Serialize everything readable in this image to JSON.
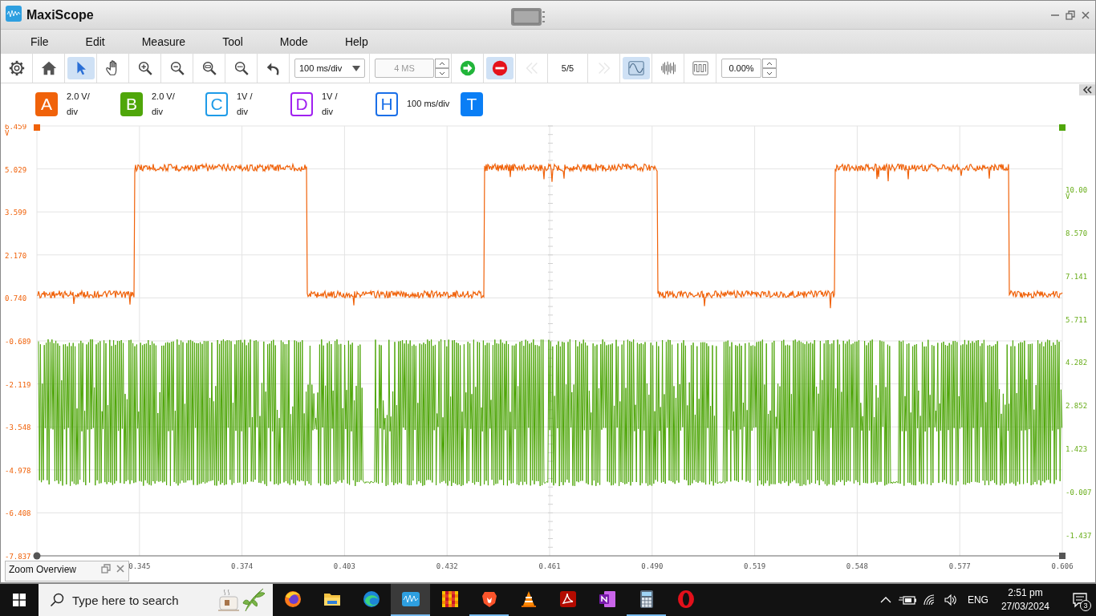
{
  "window": {
    "title": "MaxiScope"
  },
  "menu": [
    {
      "label": "File"
    },
    {
      "label": "Edit"
    },
    {
      "label": "Measure"
    },
    {
      "label": "Tool"
    },
    {
      "label": "Mode"
    },
    {
      "label": "Help"
    }
  ],
  "toolbar": [
    {
      "kind": "settings",
      "selected": false,
      "disabled": false
    },
    {
      "kind": "home",
      "selected": false,
      "disabled": false
    },
    {
      "kind": "pointer",
      "selected": true,
      "disabled": false
    },
    {
      "kind": "hand",
      "selected": false,
      "disabled": false
    },
    {
      "kind": "zoomin",
      "selected": false,
      "disabled": false
    },
    {
      "kind": "zoomout",
      "selected": false,
      "disabled": false
    },
    {
      "kind": "zoomfit",
      "selected": false,
      "disabled": false
    },
    {
      "kind": "zoomreset",
      "selected": false,
      "disabled": false
    },
    {
      "kind": "undo",
      "selected": false,
      "disabled": false
    },
    {
      "kind": "dropdown",
      "value": "100 ms/div"
    },
    {
      "kind": "spinner",
      "value": "4 MS",
      "disabled": true
    },
    {
      "kind": "run",
      "selected": false,
      "disabled": false
    },
    {
      "kind": "stop",
      "selected": true,
      "disabled": false
    },
    {
      "kind": "rewind",
      "selected": false,
      "disabled": true
    },
    {
      "kind": "counter",
      "value": "5/5"
    },
    {
      "kind": "forward",
      "selected": false,
      "disabled": true
    },
    {
      "kind": "sine",
      "selected": true,
      "disabled": false
    },
    {
      "kind": "bars",
      "selected": false,
      "disabled": false
    },
    {
      "kind": "square",
      "selected": false,
      "disabled": false
    },
    {
      "kind": "spinner",
      "value": "0.00%",
      "disabled": false
    }
  ],
  "channels": [
    {
      "kind": "channel",
      "letter": "A",
      "scale": "2.0 V/div",
      "color": "#f0620a",
      "enabled": true
    },
    {
      "kind": "channel",
      "letter": "B",
      "scale": "2.0 V/div",
      "color": "#4fa60a",
      "enabled": true
    },
    {
      "kind": "channel",
      "letter": "C",
      "scale": "1V /div",
      "color": "#1e9be8",
      "enabled": false
    },
    {
      "kind": "channel",
      "letter": "D",
      "scale": "1V /div",
      "color": "#a020f0",
      "enabled": false
    },
    {
      "kind": "timebase",
      "letter": "H",
      "scale": "100 ms/div",
      "color": "#1a6fe8",
      "enabled": false
    },
    {
      "kind": "trigger",
      "letter": "T",
      "color": "#0a7ef5",
      "enabled": true
    }
  ],
  "plot": {
    "left_axis": {
      "labels": [
        "6.459",
        "5.029",
        "3.599",
        "2.170",
        "0.740",
        "-0.689",
        "-2.119",
        "-3.548",
        "-4.978",
        "-6.408",
        "-7.837"
      ],
      "unit": "V"
    },
    "right_axis": {
      "labels": [
        "10.00",
        "8.570",
        "7.141",
        "5.711",
        "4.282",
        "2.852",
        "1.423",
        "-0.007",
        "-1.437"
      ],
      "unit": "V"
    },
    "x_axis": {
      "labels": [
        "0.345",
        "0.374",
        "0.403",
        "0.432",
        "0.461",
        "0.490",
        "0.519",
        "0.548",
        "0.577",
        "0.606"
      ]
    }
  },
  "zoom_overview": {
    "title": "Zoom Overview"
  },
  "taskbar": {
    "search": {
      "placeholder": "Type here to search"
    },
    "apps": [
      {
        "kind": "orb",
        "running": false,
        "selected": false
      },
      {
        "kind": "folder",
        "running": false,
        "selected": false
      },
      {
        "kind": "swirl",
        "running": false,
        "selected": false
      },
      {
        "kind": "scope",
        "running": true,
        "selected": true
      },
      {
        "kind": "grid",
        "running": false,
        "selected": false
      },
      {
        "kind": "shield",
        "running": true,
        "selected": false
      },
      {
        "kind": "cone",
        "running": false,
        "selected": false
      },
      {
        "kind": "pdf",
        "running": false,
        "selected": false
      },
      {
        "kind": "notebook",
        "running": false,
        "selected": false
      },
      {
        "kind": "calculator",
        "running": true,
        "selected": false
      },
      {
        "kind": "ring",
        "running": false,
        "selected": false
      }
    ],
    "tray": {
      "language": "ENG",
      "time": "2:51 pm",
      "date": "27/03/2024",
      "notifications": "3"
    }
  }
}
